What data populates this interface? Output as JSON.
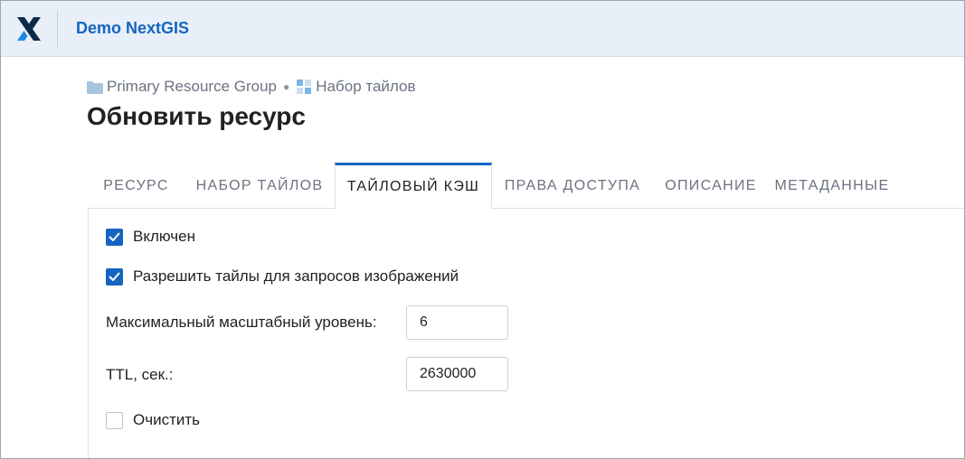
{
  "header": {
    "title": "Demo NextGIS",
    "logo_icon": "nextgis-logo-icon"
  },
  "breadcrumb": [
    {
      "label": "Primary Resource Group",
      "icon": "folder-icon"
    },
    {
      "label": "Набор тайлов",
      "icon": "tileset-icon"
    }
  ],
  "page_title": "Обновить ресурс",
  "tabs": [
    {
      "label": "РЕСУРС",
      "active": false
    },
    {
      "label": "НАБОР ТАЙЛОВ",
      "active": false
    },
    {
      "label": "ТАЙЛОВЫЙ КЭШ",
      "active": true
    },
    {
      "label": "ПРАВА ДОСТУПА",
      "active": false
    },
    {
      "label": "ОПИСАНИЕ",
      "active": false
    },
    {
      "label": "МЕТАДАННЫЕ",
      "active": false
    }
  ],
  "form": {
    "enabled_label": "Включен",
    "enabled": true,
    "image_compat_label": "Разрешить тайлы для запросов изображений",
    "image_compat": true,
    "max_z_label": "Максимальный масштабный уровень:",
    "max_z_value": "6",
    "ttl_label": "TTL, сек.:",
    "ttl_value": "2630000",
    "flush_label": "Очистить",
    "flush": false
  },
  "colors": {
    "accent": "#1565c0",
    "header_bg": "#e8eff8"
  }
}
